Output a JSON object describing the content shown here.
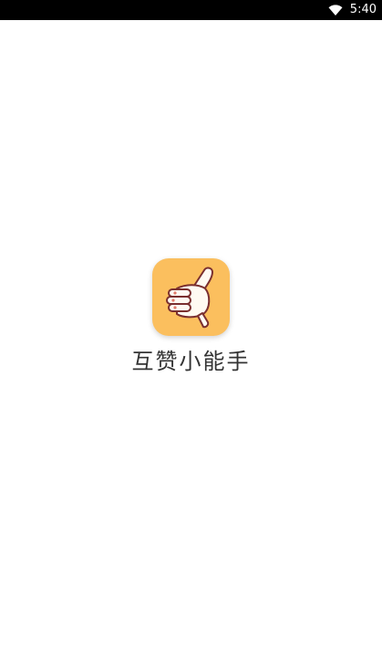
{
  "status_bar": {
    "time": "5:40",
    "wifi_icon": "wifi-icon"
  },
  "splash": {
    "app_icon": "thumbs-up-hand-icon",
    "app_name": "互赞小能手",
    "icon_background_color": "#fbbf5e"
  }
}
